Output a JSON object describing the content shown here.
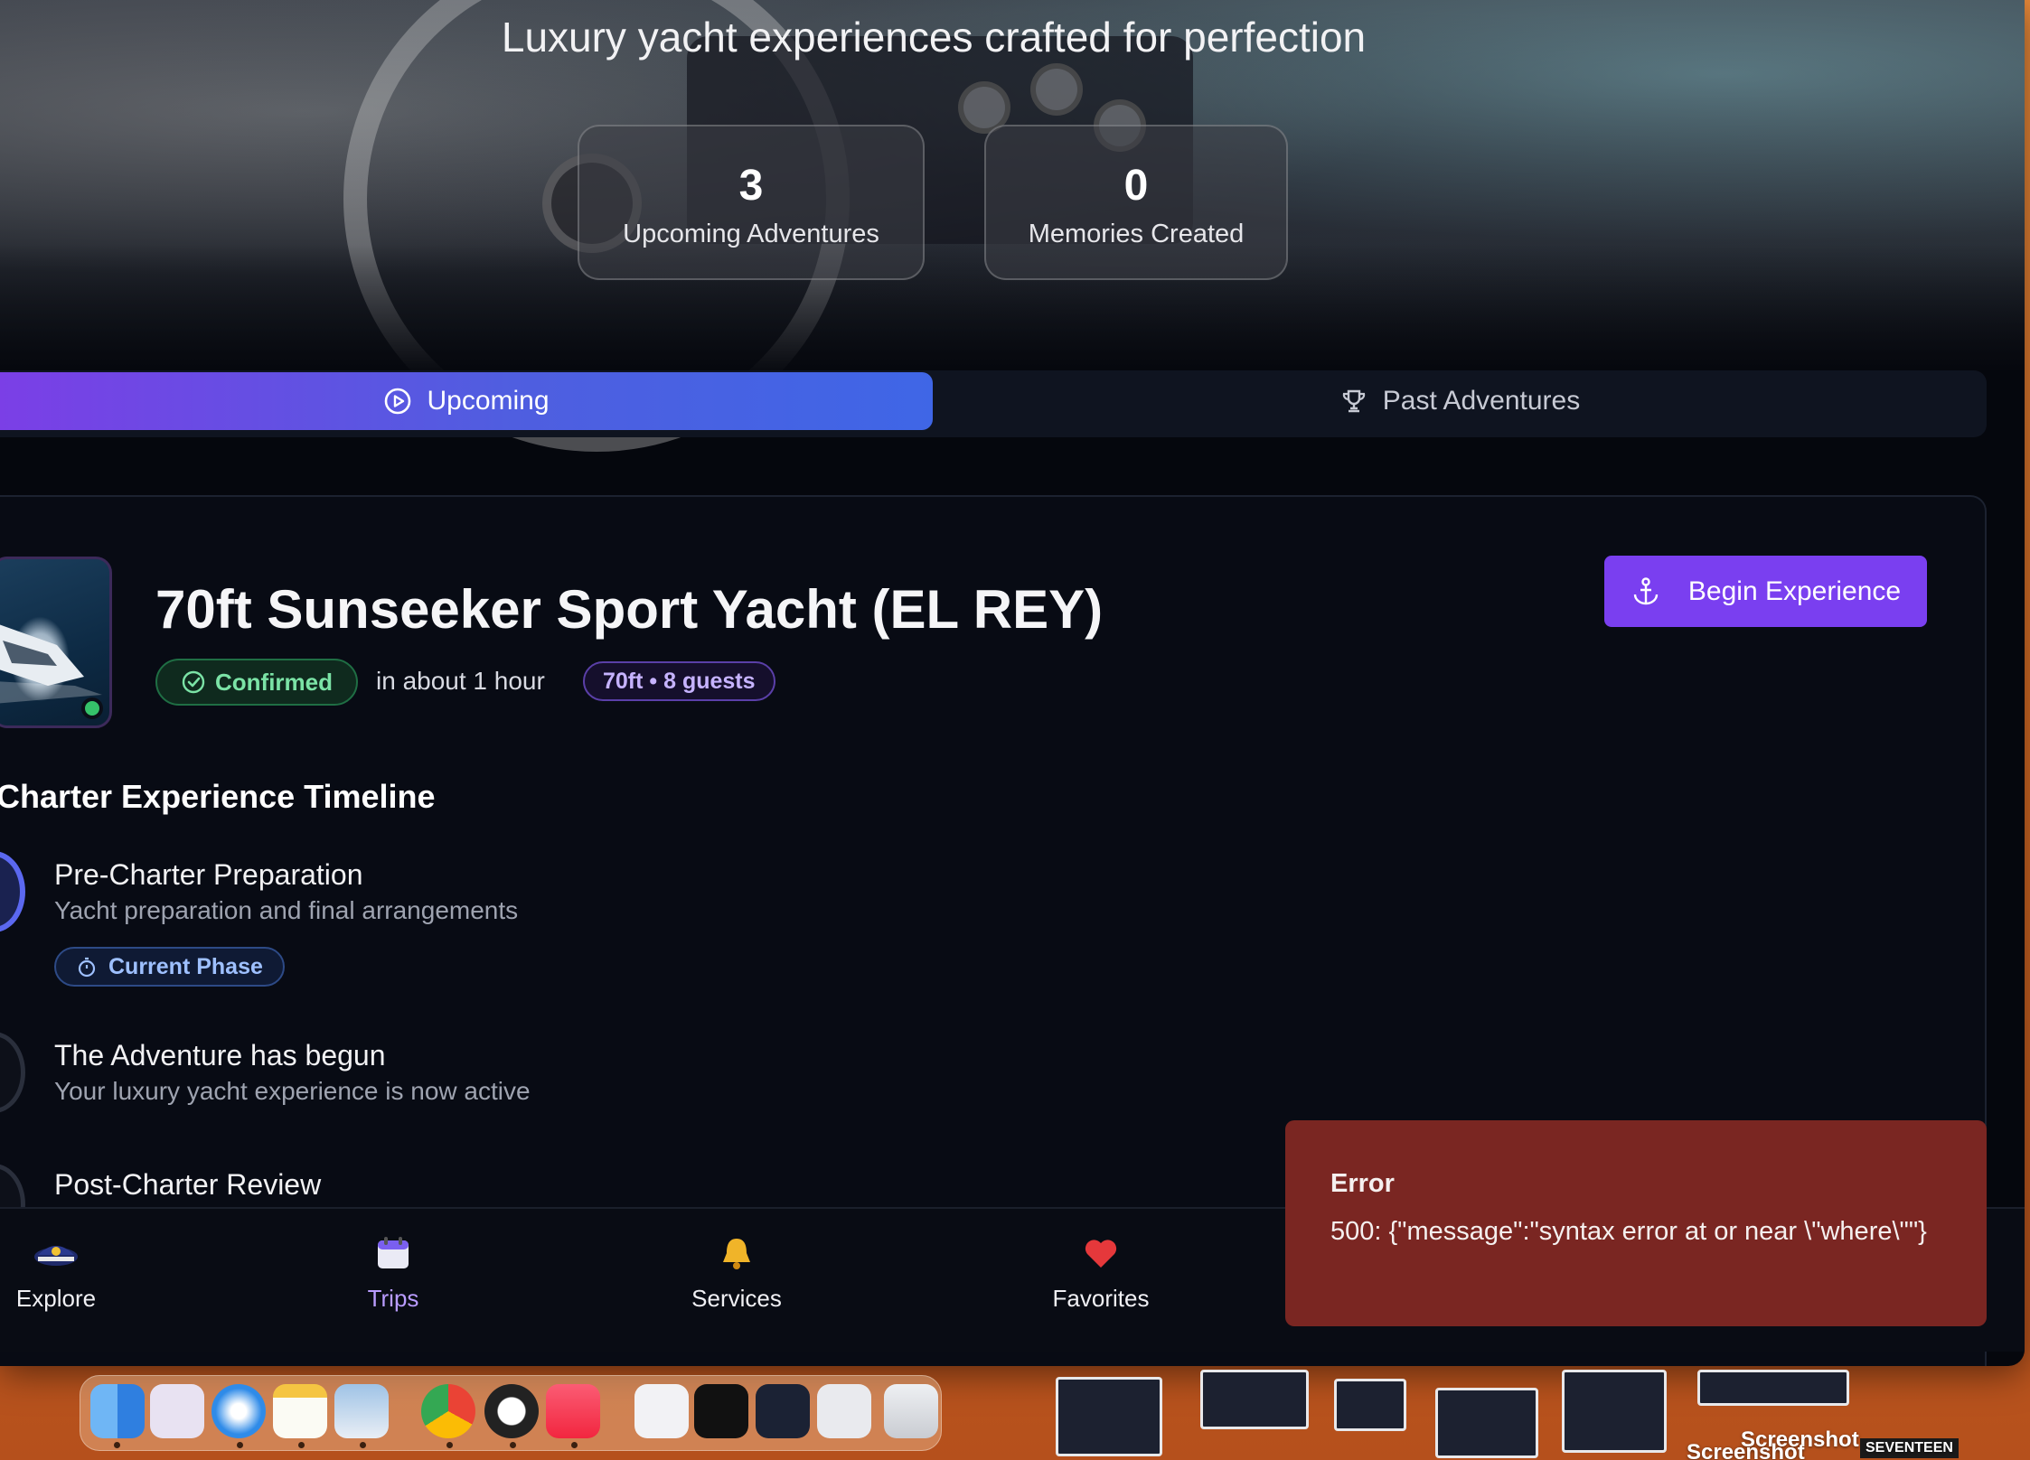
{
  "hero": {
    "tagline": "Luxury yacht experiences crafted for perfection",
    "stats": [
      {
        "value": "3",
        "label": "Upcoming Adventures"
      },
      {
        "value": "0",
        "label": "Memories Created"
      }
    ]
  },
  "tabs": {
    "active": {
      "label": "Upcoming",
      "icon": "play-circle-icon"
    },
    "inactive": {
      "label": "Past Adventures",
      "icon": "trophy-icon"
    }
  },
  "booking": {
    "title": "70ft Sunseeker Sport Yacht (EL REY)",
    "status": "Confirmed",
    "when": "in about 1 hour",
    "spec": "70ft • 8 guests",
    "begin_label": "Begin Experience"
  },
  "timeline": {
    "title": "Charter Experience Timeline",
    "steps": [
      {
        "title": "Pre-Charter Preparation",
        "subtitle": "Yacht preparation and final arrangements",
        "badge": "Current Phase"
      },
      {
        "title": "The Adventure has begun",
        "subtitle": "Your luxury yacht experience is now active"
      },
      {
        "title": "Post-Charter Review"
      }
    ]
  },
  "nav": [
    {
      "label": "Explore",
      "icon": "captain-hat-icon"
    },
    {
      "label": "Trips",
      "icon": "calendar-icon"
    },
    {
      "label": "Services",
      "icon": "bell-icon"
    },
    {
      "label": "Favorites",
      "icon": "heart-icon"
    }
  ],
  "toast": {
    "title": "Error",
    "message": "500: {\"message\":\"syntax error at or near \\\"where\\\"\"}"
  },
  "desktop": {
    "labels": [
      "Screenshot",
      "Screenshot",
      "SEVENTEEN"
    ]
  },
  "colors": {
    "accent": "#7a3ff0",
    "tab_gradient_start": "#7b3fe6",
    "tab_gradient_end": "#3f66e6",
    "success": "#35c26a",
    "error_bg": "#7a2622"
  }
}
